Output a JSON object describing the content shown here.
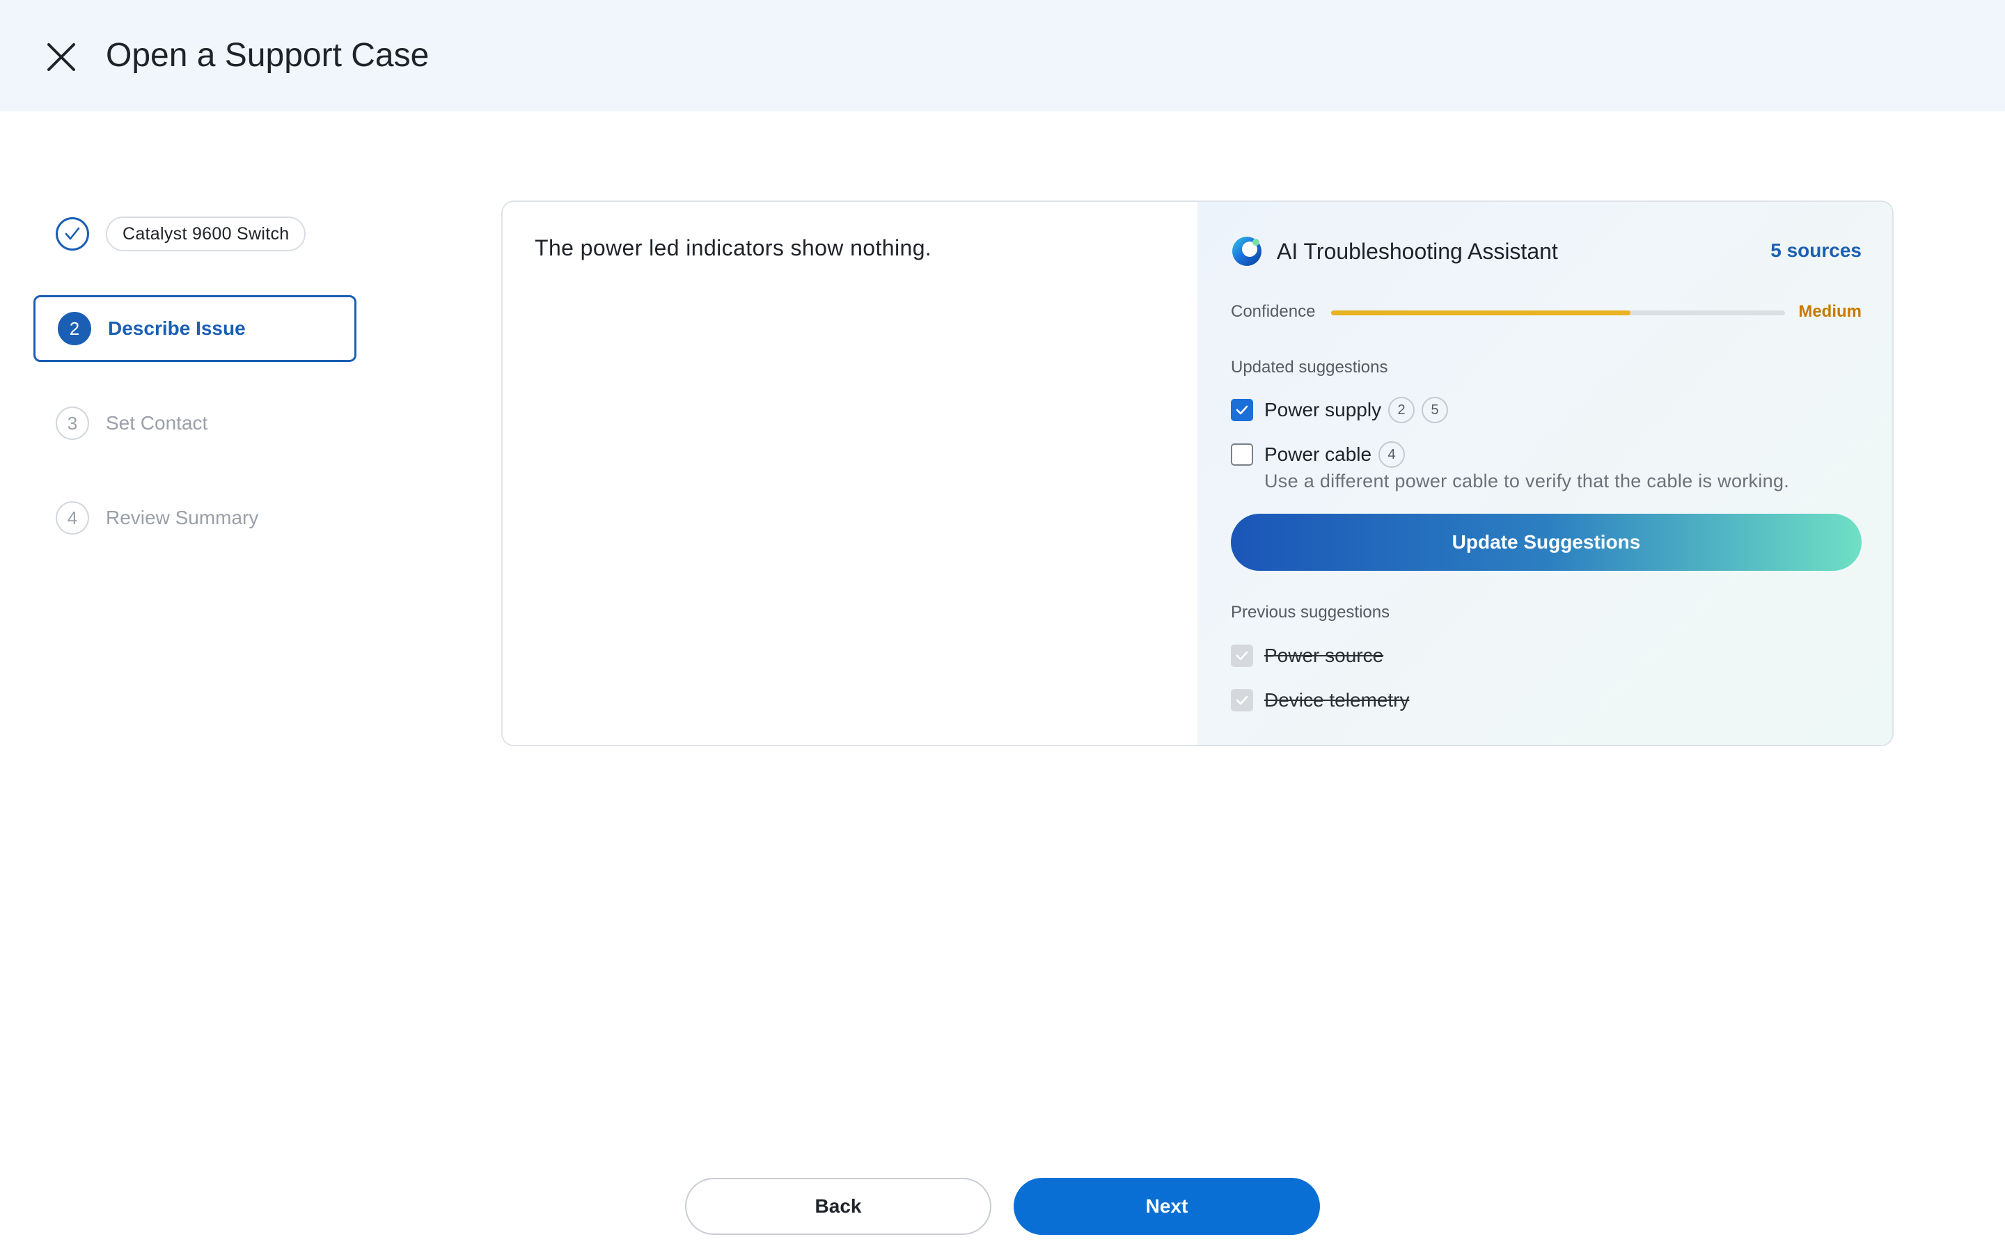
{
  "header": {
    "title": "Open a Support Case",
    "close_icon": "close-icon"
  },
  "stepper": {
    "steps": [
      {
        "number": "1",
        "label": "Catalyst 9600 Switch",
        "state": "completed",
        "icon": "check-icon"
      },
      {
        "number": "2",
        "label": "Describe Issue",
        "state": "active"
      },
      {
        "number": "3",
        "label": "Set Contact",
        "state": "upcoming"
      },
      {
        "number": "4",
        "label": "Review Summary",
        "state": "upcoming"
      }
    ]
  },
  "issue": {
    "description": "The power led indicators show nothing."
  },
  "assistant": {
    "title": "AI Troubleshooting Assistant",
    "logo_icon": "ai-assistant-logo-icon",
    "sources_link": "5 sources",
    "confidence": {
      "label": "Confidence",
      "value": "Medium",
      "level": 0.66,
      "color": "#e8b323"
    },
    "updated_label": "Updated suggestions",
    "updated": [
      {
        "label": "Power supply",
        "checked": true,
        "badges": [
          "2",
          "5"
        ]
      },
      {
        "label": "Power cable",
        "checked": false,
        "badges": [
          "4"
        ],
        "hint": "Use a different power cable to verify that the cable is working."
      }
    ],
    "update_button": "Update Suggestions",
    "previous_label": "Previous suggestions",
    "previous": [
      {
        "label": "Power source",
        "checked": true,
        "disabled": true
      },
      {
        "label": "Device telemetry",
        "checked": true,
        "disabled": true
      }
    ]
  },
  "footer": {
    "back": "Back",
    "next": "Next"
  },
  "colors": {
    "accent": "#1a5fb4",
    "primary_button": "#0a6fd4",
    "header_bg": "#f1f6fc",
    "confidence_text": "#c77a00"
  }
}
